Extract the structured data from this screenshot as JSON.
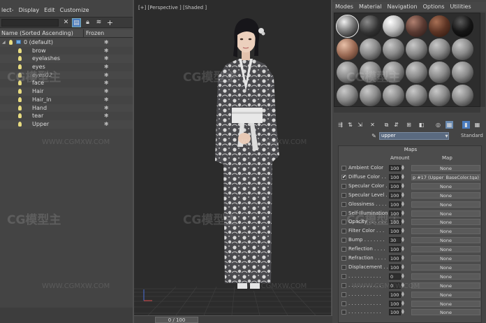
{
  "scene_explorer": {
    "menu": [
      "lect-",
      "Display",
      "Edit",
      "Customize"
    ],
    "columns": {
      "name": "Name (Sorted Ascending)",
      "frozen": "Frozen"
    },
    "layer": "0 (default)",
    "objects": [
      "brow",
      "eyelashes",
      "eyes",
      "eyes02",
      "face",
      "Hair",
      "Hair_in",
      "Hand",
      "tear",
      "Upper"
    ]
  },
  "viewport": {
    "label": "[+] [Perspective ] [Shaded ]",
    "time_slider": "0 / 100"
  },
  "material_editor": {
    "menu": [
      "Modes",
      "Material",
      "Navigation",
      "Options",
      "Utilities"
    ],
    "material_name": "upper",
    "material_type": "Standard",
    "rollout_title": "Maps",
    "col_amount": "Amount",
    "col_map": "Map",
    "maps": [
      {
        "label": "Ambient Color",
        "amount": "100",
        "map": "None",
        "checked": false
      },
      {
        "label": "Diffuse Color . .",
        "amount": "100",
        "map": "p #17 (Upper_BaseColor.tga)",
        "checked": true
      },
      {
        "label": "Specular Color .",
        "amount": "100",
        "map": "None",
        "checked": false
      },
      {
        "label": "Specular Level .",
        "amount": "100",
        "map": "None",
        "checked": false
      },
      {
        "label": "Glossiness . . . .",
        "amount": "100",
        "map": "None",
        "checked": false
      },
      {
        "label": "Self-Illumination .",
        "amount": "100",
        "map": "None",
        "checked": false
      },
      {
        "label": "Opacity . . . . . .",
        "amount": "100",
        "map": "None",
        "checked": false
      },
      {
        "label": "Filter Color . . .",
        "amount": "100",
        "map": "None",
        "checked": false
      },
      {
        "label": "Bump . . . . . . .",
        "amount": "30",
        "map": "None",
        "checked": false
      },
      {
        "label": "Reflection . . . .",
        "amount": "100",
        "map": "None",
        "checked": false
      },
      {
        "label": "Refraction . . . .",
        "amount": "100",
        "map": "None",
        "checked": false
      },
      {
        "label": "Displacement . .",
        "amount": "100",
        "map": "None",
        "checked": false
      },
      {
        "label": ". . . . . . . . . . .",
        "amount": "0",
        "map": "None",
        "checked": false
      },
      {
        "label": ". . . . . . . . . . .",
        "amount": "0",
        "map": "None",
        "checked": false
      },
      {
        "label": ". . . . . . . . . . .",
        "amount": "100",
        "map": "None",
        "checked": false
      },
      {
        "label": ". . . . . . . . . . .",
        "amount": "100",
        "map": "None",
        "checked": false
      },
      {
        "label": ". . . . . . . . . . .",
        "amount": "100",
        "map": "None",
        "checked": false
      }
    ]
  },
  "watermarks": {
    "logo": "CG模型主",
    "url": "WWW.CGMXW.COM"
  }
}
